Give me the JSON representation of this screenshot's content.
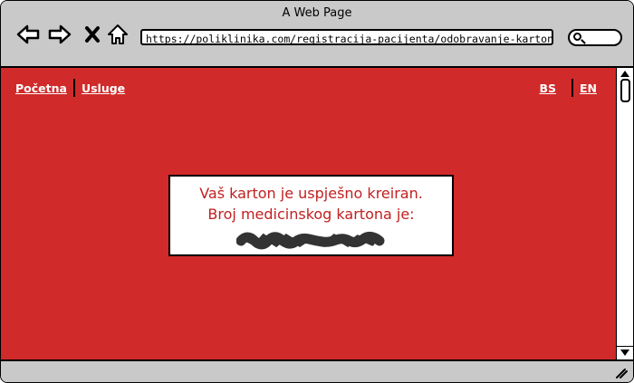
{
  "window": {
    "title": "A Web Page"
  },
  "toolbar": {
    "url": "https://poliklinika.com/registracija-pacijenta/odobravanje-kartona",
    "icons": [
      "back-arrow-icon",
      "forward-arrow-icon",
      "close-x-icon",
      "home-icon",
      "search-icon"
    ]
  },
  "nav": {
    "home_label": "Početna",
    "services_label": "Usluge"
  },
  "lang": {
    "bs_label": "BS",
    "en_label": "EN"
  },
  "message": {
    "line1": "Vaš karton je uspješno kreiran.",
    "line2": "Broj medicinskog kartona je:"
  },
  "colors": {
    "page_bg": "#d02a2a",
    "message_text": "#c22020",
    "chrome": "#c9c9c9"
  }
}
